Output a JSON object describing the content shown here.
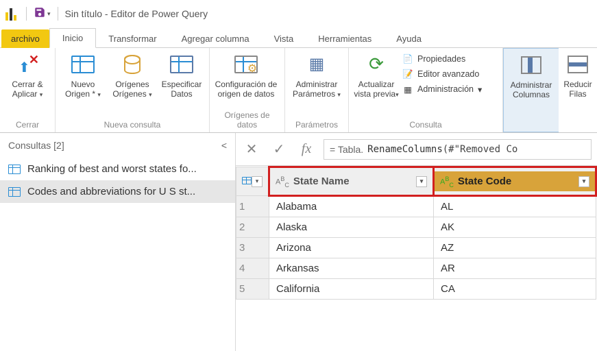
{
  "titlebar": {
    "title": "Sin título -  Editor de Power Query"
  },
  "tabs": {
    "file": "archivo",
    "items": [
      "Inicio",
      "Transformar",
      "Agregar columna",
      "Vista",
      "Herramientas",
      "Ayuda"
    ],
    "active_index": 0
  },
  "ribbon": {
    "close": {
      "label": "Cerrar & Aplicar",
      "group": "Cerrar"
    },
    "new_query": {
      "group": "Nueva consulta",
      "new_source": "Nuevo Origen",
      "recent_sources": "Orígenes Orígenes",
      "enter_data": "Especificar Datos"
    },
    "data_sources": {
      "group": "Orígenes de datos",
      "btn": "Configuración de origen de datos"
    },
    "parameters": {
      "group": "Parámetros",
      "btn": "Administrar Parámetros"
    },
    "query": {
      "group": "Consulta",
      "refresh": "Actualizar vista previa",
      "properties": "Propiedades",
      "advanced": "Editor avanzado",
      "manage": "Administración"
    },
    "columns": {
      "label": "Administrar Columnas"
    },
    "rows": {
      "label": "Reducir Filas"
    }
  },
  "queries_pane": {
    "header": "Consultas [2]",
    "items": [
      "Ranking of best and worst states fo...",
      "Codes and abbreviations for U S st..."
    ],
    "selected_index": 1
  },
  "formula": {
    "prefix": "= Tabla.",
    "func": "RenameColumns",
    "rest": "(#\"Removed Co"
  },
  "grid": {
    "type_label": "AᴮC",
    "columns": [
      "State Name",
      "State Code"
    ],
    "rows": [
      [
        "Alabama",
        "AL"
      ],
      [
        "Alaska",
        "AK"
      ],
      [
        "Arizona",
        "AZ"
      ],
      [
        "Arkansas",
        "AR"
      ],
      [
        "California",
        "CA"
      ]
    ]
  }
}
